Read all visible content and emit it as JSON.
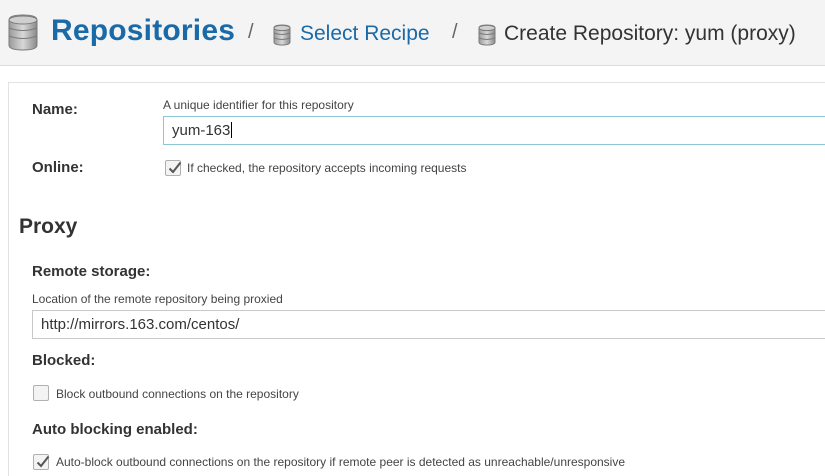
{
  "breadcrumb": {
    "root": "Repositories",
    "separator": "/",
    "step1": "Select Recipe",
    "current": "Create Repository: yum (proxy)"
  },
  "form": {
    "name": {
      "label": "Name:",
      "help": "A unique identifier for this repository",
      "value": "yum-163"
    },
    "online": {
      "label": "Online:",
      "checked": true,
      "text": "If checked, the repository accepts incoming requests"
    }
  },
  "proxy": {
    "title": "Proxy",
    "remote_storage": {
      "label": "Remote storage:",
      "help": "Location of the remote repository being proxied",
      "value": "http://mirrors.163.com/centos/"
    },
    "blocked": {
      "label": "Blocked:",
      "checked": false,
      "text": "Block outbound connections on the repository"
    },
    "auto_blocking": {
      "label": "Auto blocking enabled:",
      "checked": true,
      "text": "Auto-block outbound connections on the repository if remote peer is detected as unreachable/unresponsive"
    }
  },
  "colors": {
    "link": "#1b6aa8",
    "header_bg": "#f4f4f4",
    "focus_border": "#8ec6d8"
  },
  "icons": {
    "breadcrumb_root": "database-icon",
    "breadcrumb_step": "database-icon",
    "check": "checkmark-icon"
  }
}
